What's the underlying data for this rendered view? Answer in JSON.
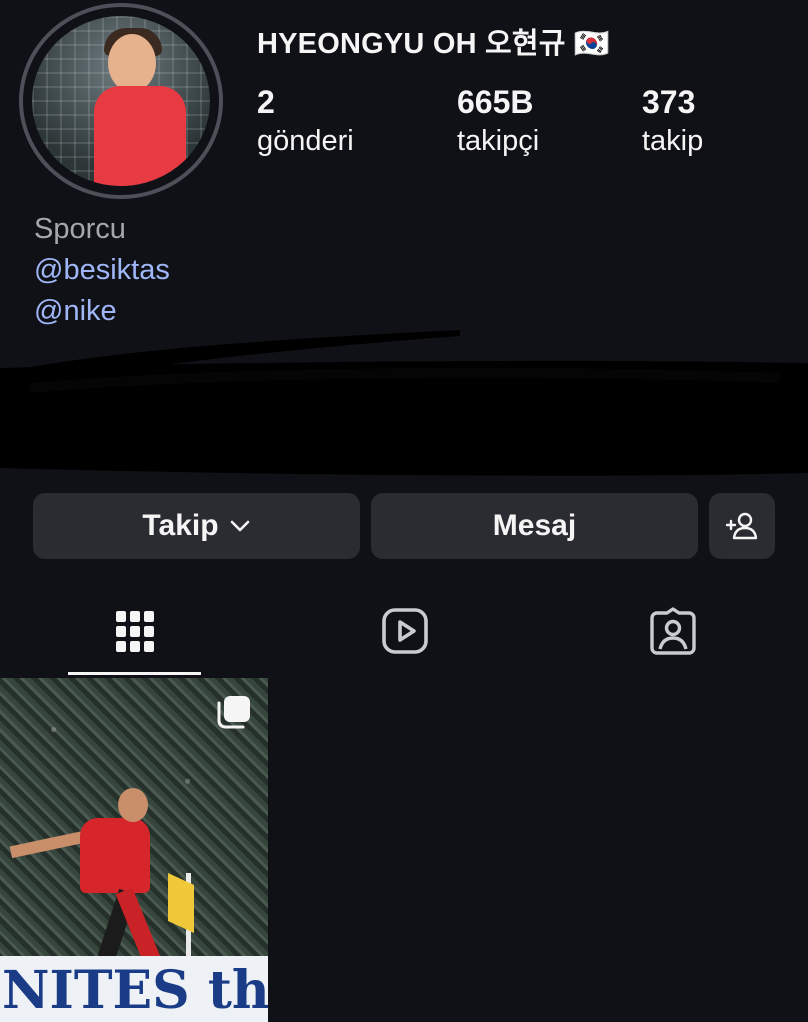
{
  "profile": {
    "username": "HYEONGYU OH 오현규 🇰🇷",
    "stats": [
      {
        "value": "2",
        "label": "gönderi"
      },
      {
        "value": "665B",
        "label": "takipçi"
      },
      {
        "value": "373",
        "label": "takip"
      }
    ],
    "category": "Sporcu",
    "links": [
      "@besiktas",
      "@nike"
    ]
  },
  "actions": {
    "follow_label": "Takip",
    "message_label": "Mesaj"
  },
  "tabs": [
    {
      "icon": "grid-icon",
      "active": true
    },
    {
      "icon": "reels-icon",
      "active": false
    },
    {
      "icon": "tagged-icon",
      "active": false
    }
  ],
  "post": {
    "ad_text": "NITES the Wo"
  },
  "colors": {
    "background": "#0f1116",
    "button": "#2a2c31",
    "link": "#9fb6f7",
    "muted": "#a5a7ad"
  }
}
